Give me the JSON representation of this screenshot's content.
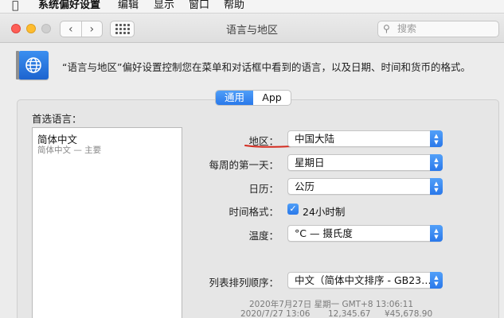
{
  "menubar": {
    "app_name": "系统偏好设置",
    "items": [
      "编辑",
      "显示",
      "窗口",
      "帮助"
    ]
  },
  "window": {
    "title": "语言与地区",
    "search_placeholder": "搜索"
  },
  "header": {
    "description": "“语言与地区”偏好设置控制您在菜单和对话框中看到的语言，以及日期、时间和货币的格式。"
  },
  "tabs": [
    {
      "label": "通用",
      "active": true
    },
    {
      "label": "App",
      "active": false
    }
  ],
  "preferred_languages": {
    "label": "首选语言：",
    "items": [
      {
        "name": "简体中文",
        "subtitle": "简体中文 — 主要"
      }
    ]
  },
  "settings": {
    "region": {
      "label": "地区：",
      "value": "中国大陆"
    },
    "first_day": {
      "label": "每周的第一天：",
      "value": "星期日"
    },
    "calendar": {
      "label": "日历：",
      "value": "公历"
    },
    "time_format": {
      "label": "时间格式：",
      "checkbox_label": "24小时制",
      "checked": true
    },
    "temperature": {
      "label": "温度：",
      "value": "°C — 摄氏度"
    },
    "sort_order": {
      "label": "列表排列顺序：",
      "value": "中文（简体中文排序 - GB23…"
    }
  },
  "samples": {
    "line1": "2020年7月27日 星期一 GMT+8 13:06:11",
    "line2_date": "2020/7/27 13:06",
    "line2_number": "12,345.67",
    "line2_currency": "¥45,678.90"
  },
  "colors": {
    "accent": "#2a79ea",
    "annotation": "#d42b1f"
  }
}
